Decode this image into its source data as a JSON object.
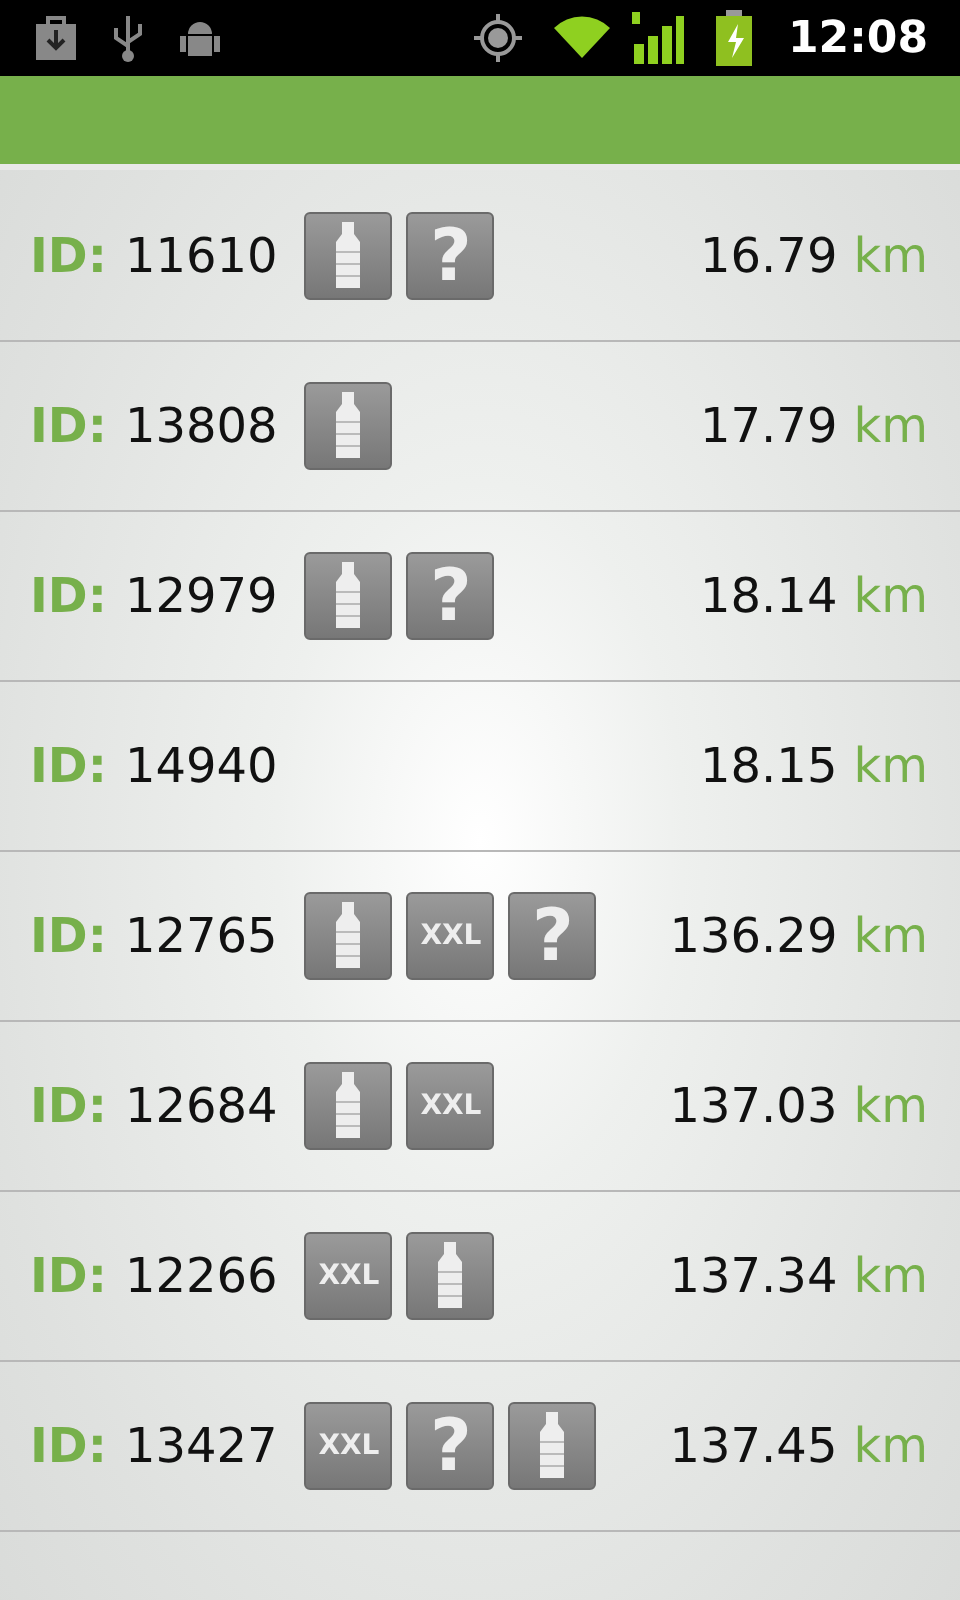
{
  "status_bar": {
    "time": "12:08"
  },
  "rows": [
    {
      "id_label": "ID:",
      "id": "11610",
      "badges": [
        {
          "kind": "bottle"
        },
        {
          "kind": "question",
          "text": "?"
        }
      ],
      "distance": "16.79",
      "unit": "km"
    },
    {
      "id_label": "ID:",
      "id": "13808",
      "badges": [
        {
          "kind": "bottle"
        }
      ],
      "distance": "17.79",
      "unit": "km"
    },
    {
      "id_label": "ID:",
      "id": "12979",
      "badges": [
        {
          "kind": "bottle"
        },
        {
          "kind": "question",
          "text": "?"
        }
      ],
      "distance": "18.14",
      "unit": "km"
    },
    {
      "id_label": "ID:",
      "id": "14940",
      "badges": [],
      "distance": "18.15",
      "unit": "km"
    },
    {
      "id_label": "ID:",
      "id": "12765",
      "badges": [
        {
          "kind": "bottle"
        },
        {
          "kind": "xxl",
          "text": "XXL"
        },
        {
          "kind": "question",
          "text": "?"
        }
      ],
      "distance": "136.29",
      "unit": "km"
    },
    {
      "id_label": "ID:",
      "id": "12684",
      "badges": [
        {
          "kind": "bottle"
        },
        {
          "kind": "xxl",
          "text": "XXL"
        }
      ],
      "distance": "137.03",
      "unit": "km"
    },
    {
      "id_label": "ID:",
      "id": "12266",
      "badges": [
        {
          "kind": "xxl",
          "text": "XXL"
        },
        {
          "kind": "bottle"
        }
      ],
      "distance": "137.34",
      "unit": "km"
    },
    {
      "id_label": "ID:",
      "id": "13427",
      "badges": [
        {
          "kind": "xxl",
          "text": "XXL"
        },
        {
          "kind": "question",
          "text": "?"
        },
        {
          "kind": "bottle"
        }
      ],
      "distance": "137.45",
      "unit": "km"
    }
  ]
}
